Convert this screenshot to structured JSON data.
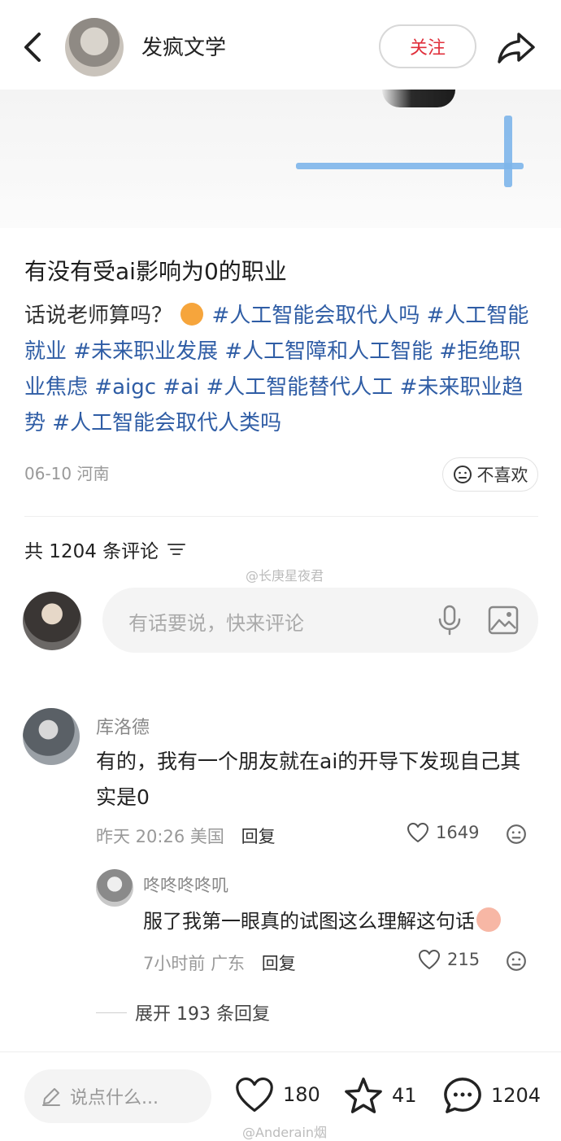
{
  "header": {
    "author_name": "发疯文学",
    "follow_label": "关注"
  },
  "post": {
    "title": "有没有受ai影响为0的职业",
    "body_prefix": "话说老师算吗？",
    "tags": [
      "#人工智能会取代人吗",
      "#人工智能就业",
      "#未来职业发展",
      "#人工智障和人工智能",
      "#拒绝职业焦虑",
      "#aigc",
      "#ai",
      "#人工智能替代人工",
      "#未来职业趋势",
      "#人工智能会取代人类吗"
    ],
    "date": "06-10",
    "location": "河南",
    "dislike_label": "不喜欢"
  },
  "comments_section": {
    "count_label": "共 1204 条评论",
    "input_placeholder": "有话要说，快来评论"
  },
  "watermarks": [
    "@长庚星夜君",
    "@Anderain烟"
  ],
  "comments": [
    {
      "user": "库洛德",
      "text": "有的，我有一个朋友就在ai的开导下发现自己其实是0",
      "time": "昨天 20:26",
      "location": "美国",
      "reply_label": "回复",
      "likes": "1649"
    },
    {
      "user": "咚咚咚咚叽",
      "text": "服了我第一眼真的试图这么理解这句话",
      "time": "7小时前",
      "location": "广东",
      "reply_label": "回复",
      "likes": "215"
    }
  ],
  "expand_label": "展开 193 条回复",
  "bottom_bar": {
    "say_placeholder": "说点什么...",
    "likes": "180",
    "stars": "41",
    "comments": "1204"
  },
  "colors": {
    "accent": "#e0303c",
    "tag": "#2f5da5",
    "muted": "#999999"
  }
}
